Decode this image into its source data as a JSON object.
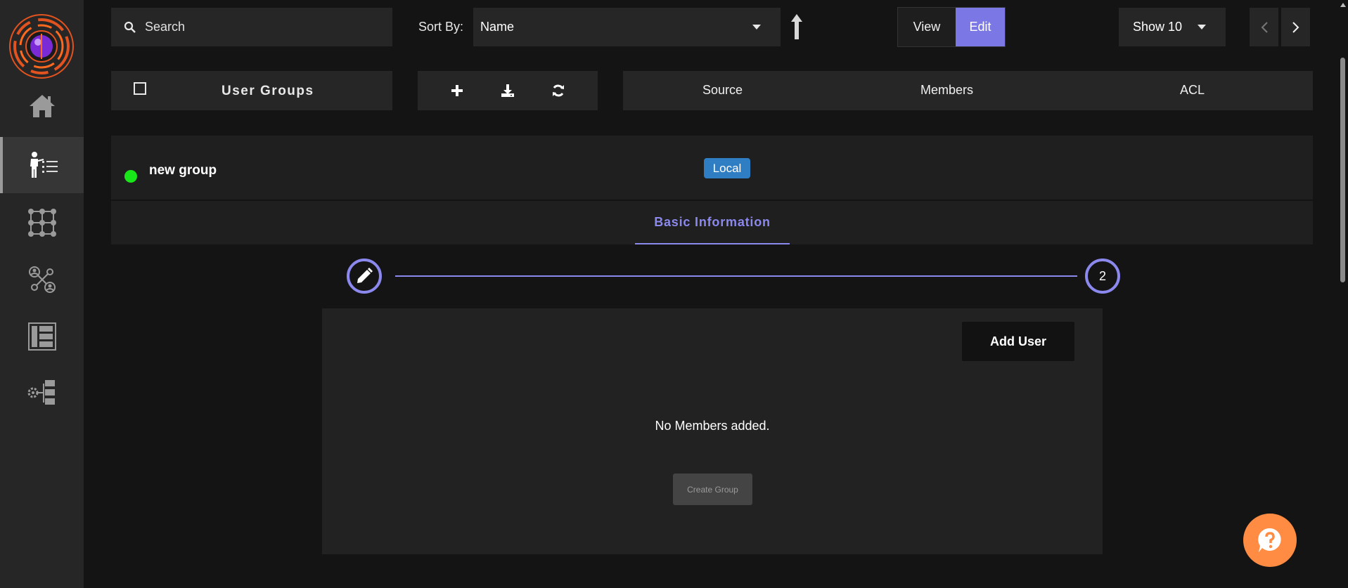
{
  "sidebar": {
    "items": [
      {
        "name": "home"
      },
      {
        "name": "user-groups",
        "active": true
      },
      {
        "name": "network"
      },
      {
        "name": "user-network"
      },
      {
        "name": "list-view"
      },
      {
        "name": "settings-tree"
      }
    ]
  },
  "toolbar": {
    "search_placeholder": "Search",
    "sort_label": "Sort By:",
    "sort_value": "Name",
    "view_label": "View",
    "edit_label": "Edit",
    "show_value": "Show 10"
  },
  "header": {
    "title": "User Groups",
    "columns": [
      "Source",
      "Members",
      "ACL"
    ]
  },
  "group": {
    "name": "new group",
    "source_badge": "Local",
    "status_color": "#19e619"
  },
  "tabs": [
    "Basic Information"
  ],
  "stepper": {
    "step2": "2"
  },
  "panel": {
    "add_user_label": "Add User",
    "empty_message": "No Members added.",
    "create_label": "Create Group"
  },
  "colors": {
    "accent": "#8b88ee",
    "edit_active": "#7b78e6",
    "badge": "#2f7ec4",
    "help": "#ff8c42"
  }
}
